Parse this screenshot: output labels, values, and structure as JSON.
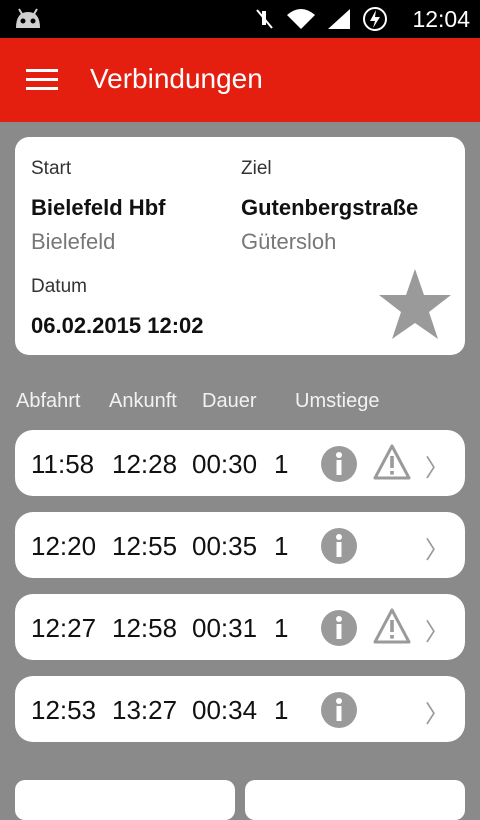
{
  "status_bar": {
    "time": "12:04",
    "icons": [
      "android-icon",
      "mute-icon",
      "wifi-icon",
      "signal-icon",
      "battery-charging-icon"
    ]
  },
  "app_bar": {
    "title": "Verbindungen",
    "menu_icon": "hamburger-menu-icon",
    "color": "#e41f0f"
  },
  "route": {
    "start_label": "Start",
    "start_station": "Bielefeld Hbf",
    "start_city": "Bielefeld",
    "dest_label": "Ziel",
    "dest_station": "Gutenbergstraße",
    "dest_city": "Gütersloh",
    "date_label": "Datum",
    "date_value": "06.02.2015 12:02",
    "favorite_icon": "star-icon"
  },
  "columns": {
    "departure": "Abfahrt",
    "arrival": "Ankunft",
    "duration": "Dauer",
    "transfers": "Umstiege"
  },
  "connections": [
    {
      "departure": "11:58",
      "arrival": "12:28",
      "duration": "00:30",
      "transfers": "1",
      "warning": true
    },
    {
      "departure": "12:20",
      "arrival": "12:55",
      "duration": "00:35",
      "transfers": "1",
      "warning": false
    },
    {
      "departure": "12:27",
      "arrival": "12:58",
      "duration": "00:31",
      "transfers": "1",
      "warning": true
    },
    {
      "departure": "12:53",
      "arrival": "13:27",
      "duration": "00:34",
      "transfers": "1",
      "warning": false
    }
  ],
  "row_chevron": "〉"
}
